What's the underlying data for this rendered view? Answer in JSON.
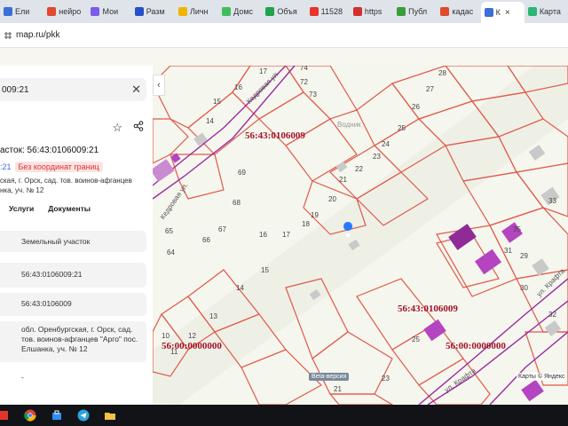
{
  "browser": {
    "tabs": [
      {
        "label": "Ели",
        "color": "#3a6fd6"
      },
      {
        "label": "нейро",
        "color": "#e04a2e"
      },
      {
        "label": "Мои",
        "color": "#7b5ce8"
      },
      {
        "label": "Разм",
        "color": "#2850c8"
      },
      {
        "label": "Личн",
        "color": "#f0b400"
      },
      {
        "label": "Домс",
        "color": "#3fbf5a"
      },
      {
        "label": "Объя",
        "color": "#20a24a"
      },
      {
        "label": "11528",
        "color": "#e8342a"
      },
      {
        "label": "https",
        "color": "#d32f2f"
      },
      {
        "label": "Публ",
        "color": "#3a9d3a"
      },
      {
        "label": "кадас",
        "color": "#e04a2e"
      },
      {
        "label": "К",
        "color": "#3a6fd6",
        "active": true
      },
      {
        "label": "Карта",
        "color": "#2bb673"
      }
    ],
    "close_symbol": "×",
    "url": "map.ru/pkk"
  },
  "panel": {
    "search_value": "009:21",
    "clear_symbol": "✕",
    "star_symbol": "☆",
    "share_symbol": "⋔",
    "title": "асток: 56:43:0106009:21",
    "id_link": ":21",
    "no_coords_badge": "Без координат границ",
    "address_short": "ская, г. Орск, сад. тов. воинов-афганцев",
    "address_short2": "нка, уч. № 12",
    "tabs": [
      "Услуги",
      "Документы"
    ],
    "rows": [
      {
        "value": "Земельный участок"
      },
      {
        "value": "56:43:0106009:21"
      },
      {
        "value": "56:43:0106009"
      },
      {
        "value": "обл. Оренбургская, г. Орск, сад. тов. воинов-афганцев \"Арго\" пос. Елшанка, уч. № 12"
      },
      {
        "value": "-"
      }
    ]
  },
  "map": {
    "collapse_symbol": "‹",
    "quarter_labels": [
      "56:43:0106009",
      "56:43:0106009",
      "56:00:0000000",
      "56:00:0000000"
    ],
    "street_labels": [
      "Кедровая ул.",
      "Кедровая ул.",
      "ул. Крафта",
      "ул. Крафта"
    ],
    "area_label": "Водник",
    "plot_numbers": [
      "17",
      "74",
      "16",
      "72",
      "15",
      "14",
      "73",
      "28",
      "27",
      "26",
      "25",
      "24",
      "23",
      "22",
      "21",
      "20",
      "19",
      "18",
      "17",
      "16",
      "15",
      "14",
      "13",
      "12",
      "11",
      "10",
      "69",
      "68",
      "67",
      "66",
      "65",
      "64",
      "35",
      "33",
      "31",
      "32",
      "30",
      "29",
      "25",
      "23",
      "21"
    ],
    "attribution": "Карты © Яндекс",
    "beta": "Beta-версия"
  },
  "colors": {
    "parcel_border": "#e05a4a",
    "quarter_label": "#a0122a",
    "building": "#c9c9c9",
    "selected_building": "#b544c0",
    "street_line": "#9a2aa0"
  }
}
